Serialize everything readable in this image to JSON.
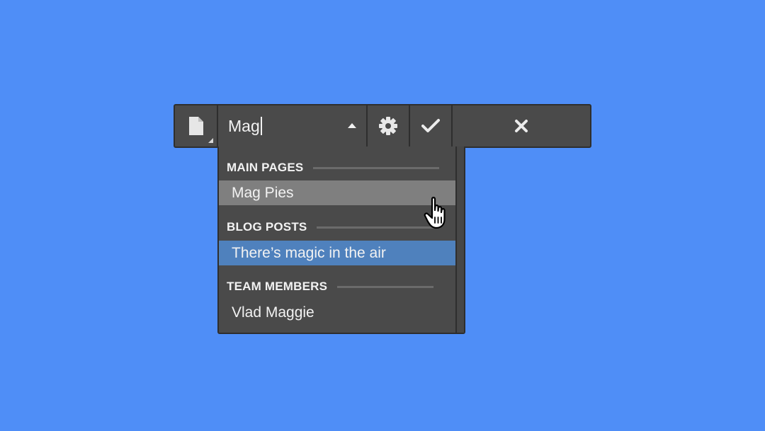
{
  "toolbar": {
    "page_icon": "page-icon",
    "search_value": "Mag",
    "collapse_icon": "caret-up-icon",
    "settings_icon": "gear-icon",
    "confirm_icon": "checkmark-icon",
    "close_icon": "close-icon"
  },
  "dropdown": {
    "groups": [
      {
        "label": "MAIN PAGES",
        "items": [
          {
            "label": "Mag Pies",
            "state": "hover"
          }
        ]
      },
      {
        "label": "BLOG POSTS",
        "items": [
          {
            "label": "There’s magic in the air",
            "state": "selected"
          }
        ]
      },
      {
        "label": "TEAM MEMBERS",
        "items": [
          {
            "label": "Vlad Maggie",
            "state": "normal"
          }
        ]
      }
    ]
  },
  "colors": {
    "background": "#4f8ef7",
    "panel": "#4a4a4a",
    "hover": "#7f7f7f",
    "selected": "#4f81bd"
  },
  "cursor_icon": "hand-pointer-icon"
}
